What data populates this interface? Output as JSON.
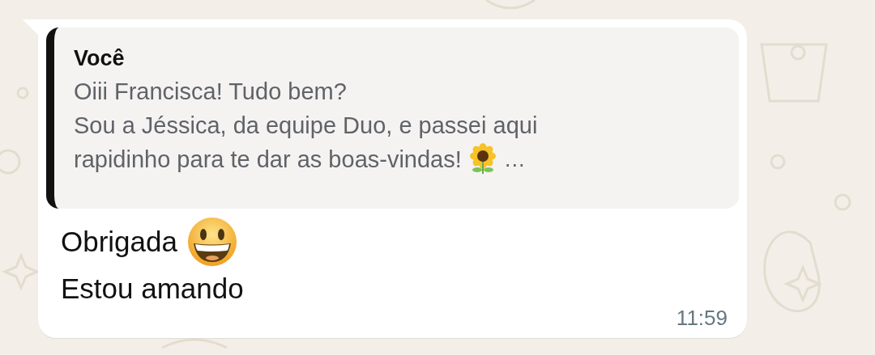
{
  "message": {
    "quote": {
      "author": "Você",
      "lines": [
        "Oiii Francisca! Tudo bem?",
        "Sou a Jéssica, da equipe Duo, e passei aqui",
        "rapidinho para te dar as boas-vindas!"
      ],
      "ellipsis": "…"
    },
    "lines": [
      "Obrigada",
      "Estou amando"
    ],
    "time": "11:59"
  }
}
